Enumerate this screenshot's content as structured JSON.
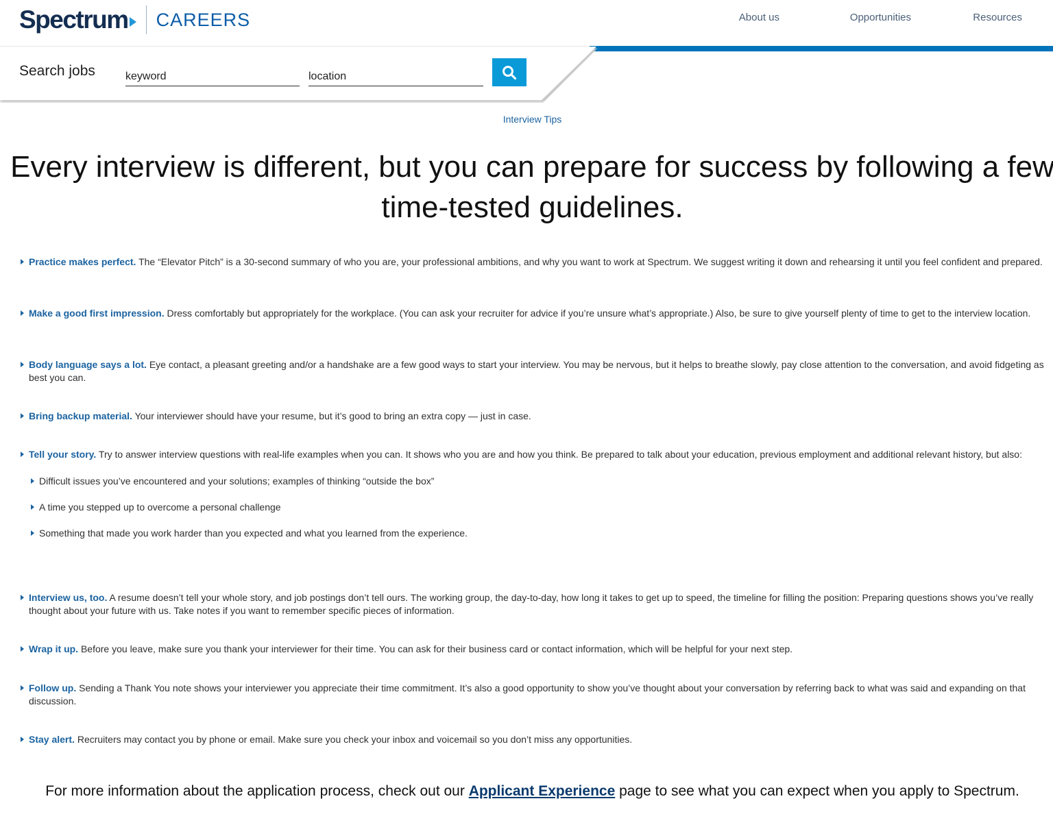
{
  "header": {
    "logo_text": "Spectrum",
    "logo_section": "CAREERS",
    "nav": [
      {
        "label": "About us"
      },
      {
        "label": "Opportunities"
      },
      {
        "label": "Resources"
      }
    ]
  },
  "search": {
    "label": "Search jobs",
    "keyword_placeholder": "keyword",
    "location_placeholder": "location",
    "button_icon": "search-icon"
  },
  "breadcrumb": "Interview Tips",
  "headline": "Every interview is different, but you can prepare for success by following a few time-tested guidelines.",
  "tips": [
    {
      "lead": "Practice makes perfect.",
      "text": " The “Elevator Pitch” is a 30-second summary of who you are, your professional ambitions, and why you want to work at Spectrum. We suggest writing it down and rehearsing it until you feel confident and prepared."
    },
    {
      "lead": "Make a good first impression.",
      "text": " Dress comfortably but appropriately for the workplace. (You can ask your recruiter for advice if you’re unsure what’s appropriate.) Also, be sure to give yourself plenty of time to get to the interview location."
    },
    {
      "lead": "Body language says a lot.",
      "text": " Eye contact, a pleasant greeting and/or a handshake are a few good ways to start your interview. You may be nervous, but it helps to breathe slowly, pay close attention to the conversation, and avoid fidgeting as best you can."
    },
    {
      "lead": "Bring backup material.",
      "text": " Your interviewer should have your resume, but it’s good to bring an extra copy — just in case."
    },
    {
      "lead": "Tell your story.",
      "text": " Try to answer interview questions with real-life examples when you can. It shows who you are and how you think. Be prepared to talk about your education, previous employment and additional relevant history, but also:",
      "subitems": [
        "Difficult issues you’ve encountered and your solutions; examples of thinking “outside the box”",
        "A time you stepped up to overcome a personal challenge",
        "Something that made you work harder than you expected and what you learned from the experience."
      ]
    },
    {
      "lead": "Interview us, too.",
      "text": " A resume doesn’t tell your whole story, and job postings don’t tell ours. The working group, the day-to-day, how long it takes to get up to speed, the timeline for filling the position: Preparing questions shows you’ve really thought about your future with us. Take notes if you want to remember specific pieces of information."
    },
    {
      "lead": "Wrap it up.",
      "text": " Before you leave, make sure you thank your interviewer for their time. You can ask for their business card or contact information, which will be helpful for your next step."
    },
    {
      "lead": "Follow up.",
      "text": " Sending a Thank You note shows your interviewer you appreciate their time commitment. It’s also a good opportunity to show you’ve thought about your conversation by referring back to what was said and expanding on that discussion."
    },
    {
      "lead": "Stay alert.",
      "text": " Recruiters may contact you by phone or email. Make sure you check your inbox and voicemail so you don’t miss any opportunities."
    }
  ],
  "footer": {
    "before": "For more information about the application process, check out our ",
    "link": "Applicant Experience",
    "after": " page to see what you can expect when you apply to Spectrum."
  },
  "colors": {
    "brand_navy": "#142e51",
    "brand_blue": "#0b5da8",
    "accent_strip": "#0073bb",
    "search_button": "#0a9ad8",
    "lead_text": "#1b63a0"
  }
}
